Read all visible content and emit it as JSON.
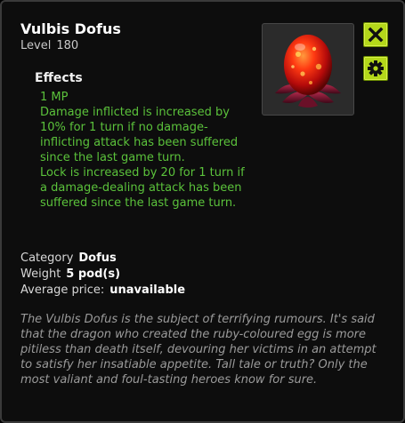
{
  "item": {
    "name": "Vulbis Dofus",
    "level_label": "Level",
    "level_value": "180"
  },
  "effects": {
    "heading": "Effects",
    "lines": [
      "1 MP",
      "Damage inflicted is increased by 10% for 1 turn if no damage-inflicting attack has been suffered since the last game turn.",
      "Lock is increased by 20 for 1 turn if a damage-dealing attack has been suffered since the last game turn."
    ]
  },
  "properties": {
    "category_label": "Category",
    "category_value": "Dofus",
    "weight_label": "Weight",
    "weight_value": "5 pod(s)",
    "price_label": "Average price:",
    "price_value": "unavailable"
  },
  "description": "The Vulbis Dofus is the subject of terrifying rumours. It's said that the dragon who created the ruby-coloured egg is more pitiless than death itself, devouring her victims in an attempt to satisfy her insatiable appetite. Tall tale or truth? Only the most valiant and foul-tasting heroes know for sure.",
  "icons": {
    "close": "close-icon",
    "settings": "gear-icon",
    "item_image": "red-dofus-egg"
  },
  "colors": {
    "effect_text": "#5bc23b",
    "button_bg": "#b4d81a",
    "panel_bg": "#0d0d0d"
  }
}
